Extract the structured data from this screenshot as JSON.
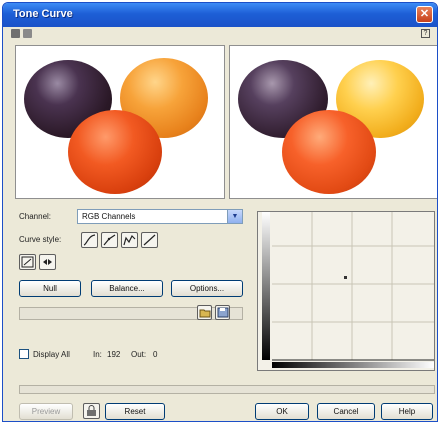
{
  "window": {
    "title": "Tone Curve"
  },
  "controls": {
    "channel_label": "Channel:",
    "channel_value": "RGB Channels",
    "curve_style_label": "Curve style:",
    "null_button": "Null",
    "balance_button": "Balance...",
    "options_button": "Options...",
    "display_all_label": "Display All",
    "readout": [
      "In:",
      "192",
      "Out:",
      "0"
    ]
  },
  "progress": {
    "fill_percent": 0
  },
  "footer": {
    "preview_button": "Preview",
    "reset_button": "Reset",
    "ok_button": "OK",
    "cancel_button": "Cancel",
    "help_button": "Help"
  }
}
